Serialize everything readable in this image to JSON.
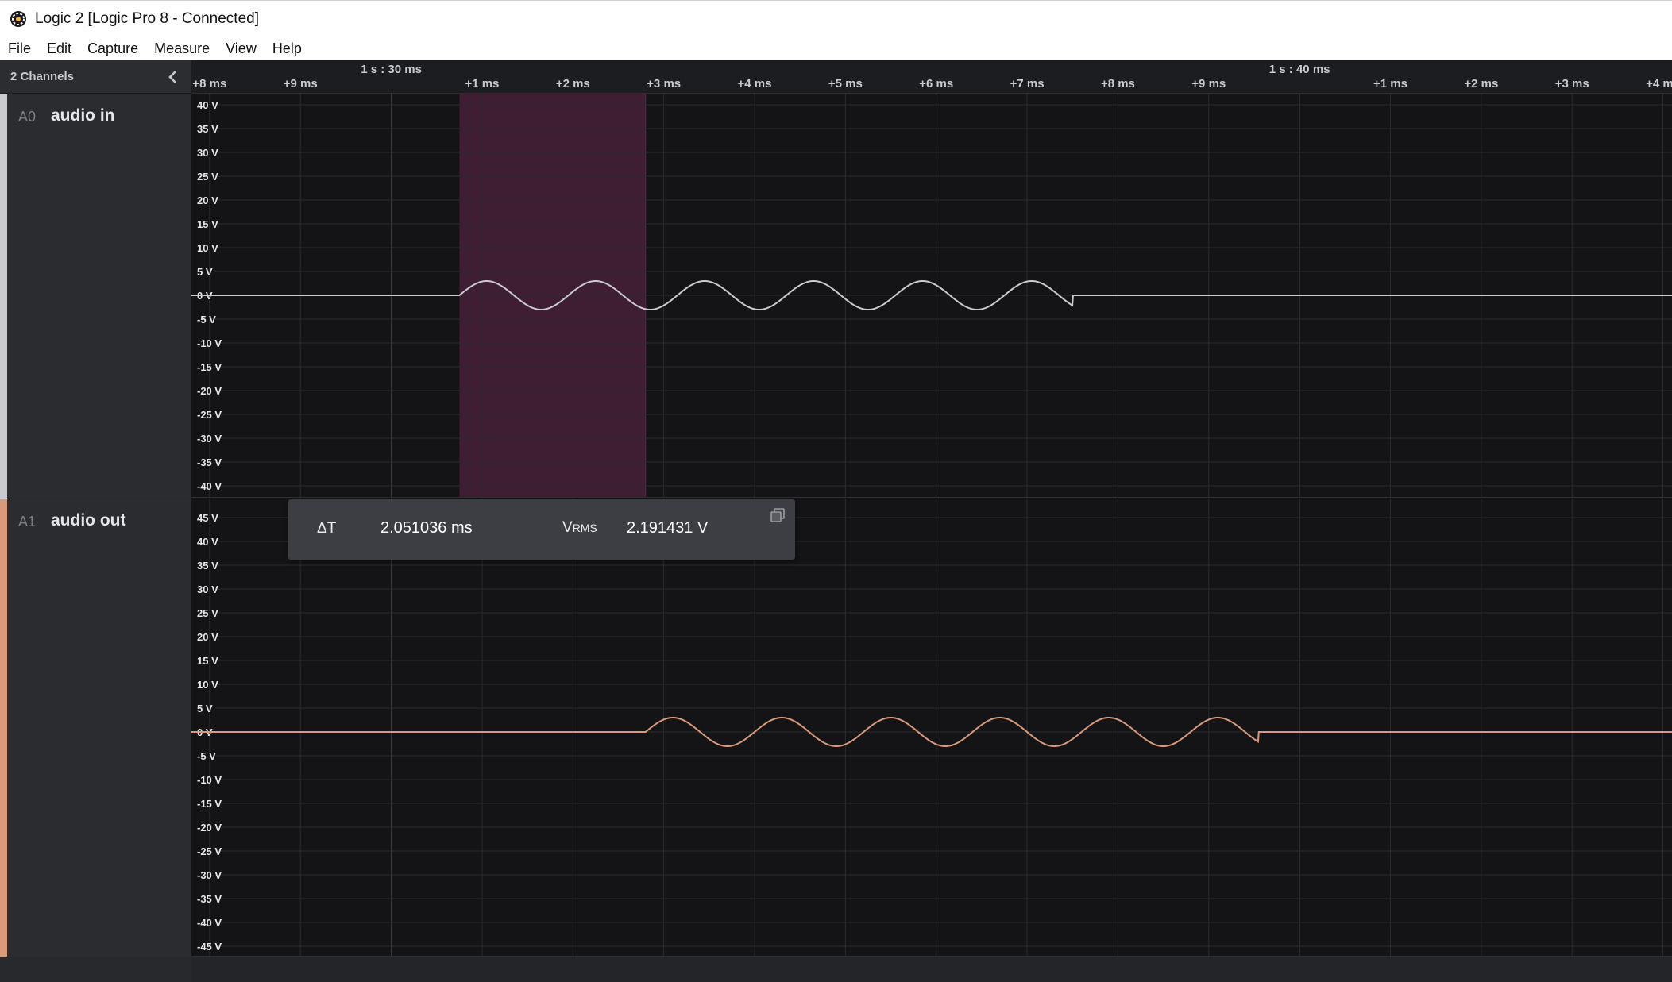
{
  "window": {
    "title": "Logic 2 [Logic Pro 8 - Connected]"
  },
  "menu": [
    "File",
    "Edit",
    "Capture",
    "Measure",
    "View",
    "Help"
  ],
  "sidebar": {
    "channels_label": "2 Channels",
    "channels": [
      {
        "id": "A0",
        "name": "audio in",
        "color": "#c9cbd0"
      },
      {
        "id": "A1",
        "name": "audio out",
        "color": "#d99a7c"
      }
    ]
  },
  "timeline": {
    "major_markers": [
      {
        "label": "1 s : 30 ms"
      },
      {
        "label": "1 s : 40 ms"
      }
    ],
    "tick_labels": [
      "+8 ms",
      "+9 ms",
      "+1 ms",
      "+2 ms",
      "+3 ms",
      "+4 ms",
      "+5 ms",
      "+6 ms",
      "+7 ms",
      "+8 ms",
      "+9 ms",
      "+1 ms",
      "+2 ms",
      "+3 ms",
      "+4 ms"
    ]
  },
  "measurement": {
    "delta_t_label": "ΔT",
    "delta_t_value": "2.051036 ms",
    "vrms_label_main": "V",
    "vrms_label_sub": "RMS",
    "vrms_value": "2.191431 V"
  },
  "chart_data": [
    {
      "type": "line",
      "channel": "A0",
      "name": "audio in",
      "x_unit": "ms",
      "x_range": [
        -2.2,
        14.1
      ],
      "ylim": [
        -40,
        40
      ],
      "y_ticks": [
        "40 V",
        "35 V",
        "30 V",
        "25 V",
        "20 V",
        "15 V",
        "10 V",
        "5 V",
        "0 V",
        "-5 V",
        "-10 V",
        "-15 V",
        "-20 V",
        "-25 V",
        "-30 V",
        "-35 V",
        "-40 V"
      ],
      "signal": {
        "form": "sine",
        "amplitude_v": 3,
        "period_ms": 1.2,
        "start_ms": 0.75,
        "end_ms": 7.5,
        "baseline_v": 0
      },
      "selection_ms": [
        0.75,
        2.8
      ],
      "color": "#c9cbd0"
    },
    {
      "type": "line",
      "channel": "A1",
      "name": "audio out",
      "x_unit": "ms",
      "x_range": [
        -2.2,
        14.1
      ],
      "ylim": [
        -45,
        45
      ],
      "y_ticks": [
        "45 V",
        "40 V",
        "35 V",
        "30 V",
        "25 V",
        "20 V",
        "15 V",
        "10 V",
        "5 V",
        "0 V",
        "-5 V",
        "-10 V",
        "-15 V",
        "-20 V",
        "-25 V",
        "-30 V",
        "-35 V",
        "-40 V",
        "-45 V"
      ],
      "signal": {
        "form": "sine",
        "amplitude_v": 3,
        "period_ms": 1.2,
        "start_ms": 2.8,
        "end_ms": 9.55,
        "baseline_v": 0
      },
      "color": "#d99a7c"
    }
  ],
  "colors": {
    "selection": "#3f1e33",
    "background": "#141416",
    "grid": "#2a2b2f"
  }
}
